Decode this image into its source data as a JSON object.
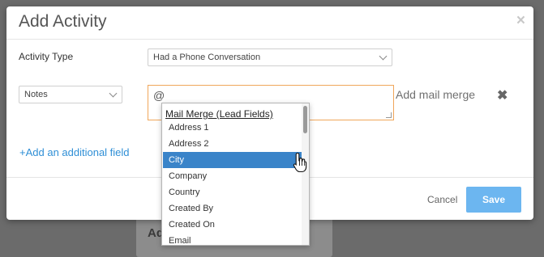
{
  "modal": {
    "title": "Add Activity",
    "close_glyph": "×"
  },
  "activity_type": {
    "label": "Activity Type",
    "selected": "Had a Phone Conversation"
  },
  "field_row": {
    "field_selected": "Notes",
    "textarea_value": "@",
    "add_mail_merge": "Add mail merge",
    "remove_glyph": "✖"
  },
  "add_field_link": "+Add an additional field",
  "footer": {
    "cancel_label": "Cancel",
    "save_label": "Save"
  },
  "mail_merge_dropdown": {
    "header": "Mail Merge (Lead Fields)",
    "items": [
      "Address 1",
      "Address 2",
      "City",
      "Company",
      "Country",
      "Created By",
      "Created On",
      "Email"
    ],
    "selected_item": "City"
  },
  "backdrop": {
    "partial_text": "Ad"
  },
  "colors": {
    "accent": "#2f8fd6",
    "save_button": "#6cb6f0",
    "selected_item": "#3a84c9",
    "focus_border": "#f0a65a"
  },
  "icons": [
    "close-icon",
    "chevron-down-icon",
    "remove-icon",
    "hand-cursor-icon"
  ]
}
